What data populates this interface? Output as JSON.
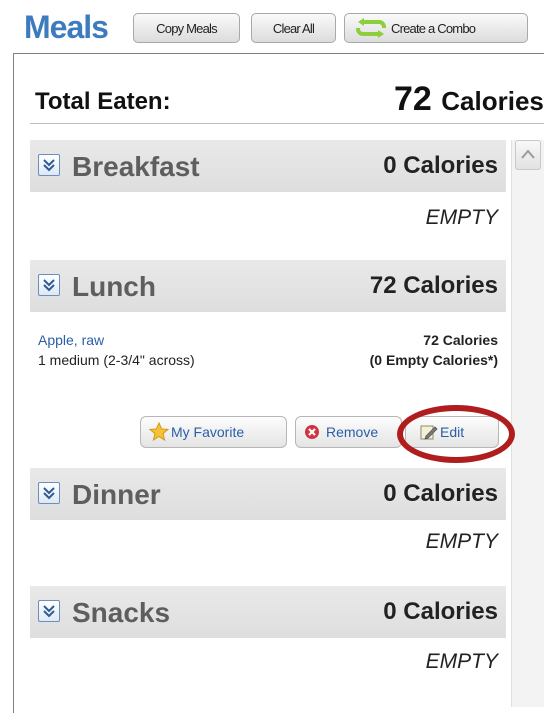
{
  "header": {
    "title": "Meals",
    "copy_label": "Copy Meals",
    "clear_label": "Clear All",
    "combo_label": "Create a Combo"
  },
  "total": {
    "label": "Total Eaten:",
    "value": "72",
    "unit": "Calories"
  },
  "meals": [
    {
      "name": "Breakfast",
      "calories": "0 Calories",
      "empty": "EMPTY"
    },
    {
      "name": "Lunch",
      "calories": "72 Calories",
      "item": {
        "name": "Apple, raw",
        "serving": "1 medium (2-3/4\" across)",
        "calories": "72 Calories",
        "empty_calories": "(0 Empty Calories*)",
        "favorite_label": "My Favorite",
        "remove_label": "Remove",
        "edit_label": "Edit"
      }
    },
    {
      "name": "Dinner",
      "calories": "0 Calories",
      "empty": "EMPTY"
    },
    {
      "name": "Snacks",
      "calories": "0 Calories",
      "empty": "EMPTY"
    }
  ],
  "colors": {
    "title": "#3d7bbf",
    "link": "#2a5ea8",
    "highlight": "#b01d1d",
    "meal_header": "#e4e4e4",
    "combo_icon": "#8ccf3a"
  },
  "icons": [
    "combo-arrows-icon",
    "expand-chevron-icon",
    "star-icon",
    "remove-x-icon",
    "edit-pencil-icon",
    "scroll-up-icon"
  ]
}
